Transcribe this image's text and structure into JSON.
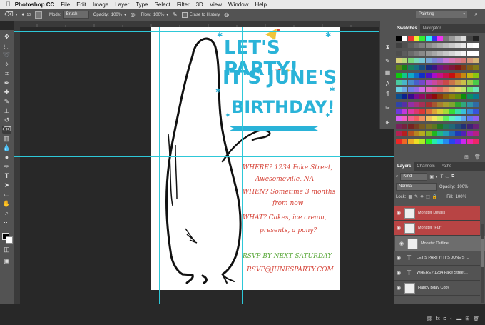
{
  "menu": {
    "apple": "",
    "app": "Photoshop CC",
    "items": [
      "File",
      "Edit",
      "Image",
      "Layer",
      "Type",
      "Select",
      "Filter",
      "3D",
      "View",
      "Window",
      "Help"
    ]
  },
  "options": {
    "size": "10",
    "mode_label": "Mode:",
    "mode_value": "Brush",
    "opacity_label": "Opacity:",
    "opacity_value": "100%",
    "flow_label": "Flow:",
    "flow_value": "100%",
    "erase_history": "Erase to History",
    "workspace": "Painting"
  },
  "panels": {
    "swatches_tab": "Swatches",
    "navigator_tab": "Navigator",
    "layers_tab": "Layers",
    "channels_tab": "Channels",
    "paths_tab": "Paths",
    "kind": "Kind",
    "blend": "Normal",
    "opacity_label": "Opacity:",
    "opacity_value": "100%",
    "lock_label": "Lock:",
    "fill_label": "Fill:",
    "fill_value": "100%",
    "layers": [
      {
        "name": "Monster Details",
        "type": "pixel",
        "style": "red"
      },
      {
        "name": "Monster \"Fur\"",
        "type": "pixel",
        "style": "red"
      },
      {
        "name": "Monster Outline",
        "type": "pixel",
        "style": "sel"
      },
      {
        "name": "LET'S PARTY! IT'S JUNE'S ...",
        "type": "text",
        "style": ""
      },
      {
        "name": "WHERE? 1234 Fake Street...",
        "type": "text",
        "style": ""
      },
      {
        "name": "Happy Bday Copy",
        "type": "pixel",
        "style": ""
      }
    ]
  },
  "doc": {
    "line1": "LET'S PARTY!",
    "line2": "IT'S JUNE'S",
    "line3": "BIRTHDAY!",
    "where": "WHERE? 1234 Fake Street,",
    "where2": "Awesomeville, NA",
    "when": "WHEN? Sometime 3 months",
    "when2": "from now",
    "what": "WHAT? Cakes, ice cream,",
    "what2": "presents, a pony?",
    "rsvp": "RSVP BY NEXT SATURDAY",
    "email": "RSVP@JUNESPARTY.COM"
  },
  "colors": {
    "accent_blue": "#2ab3d8",
    "red_text": "#d6453a",
    "green_text": "#5aa83a",
    "guide": "#2ec8d8"
  }
}
